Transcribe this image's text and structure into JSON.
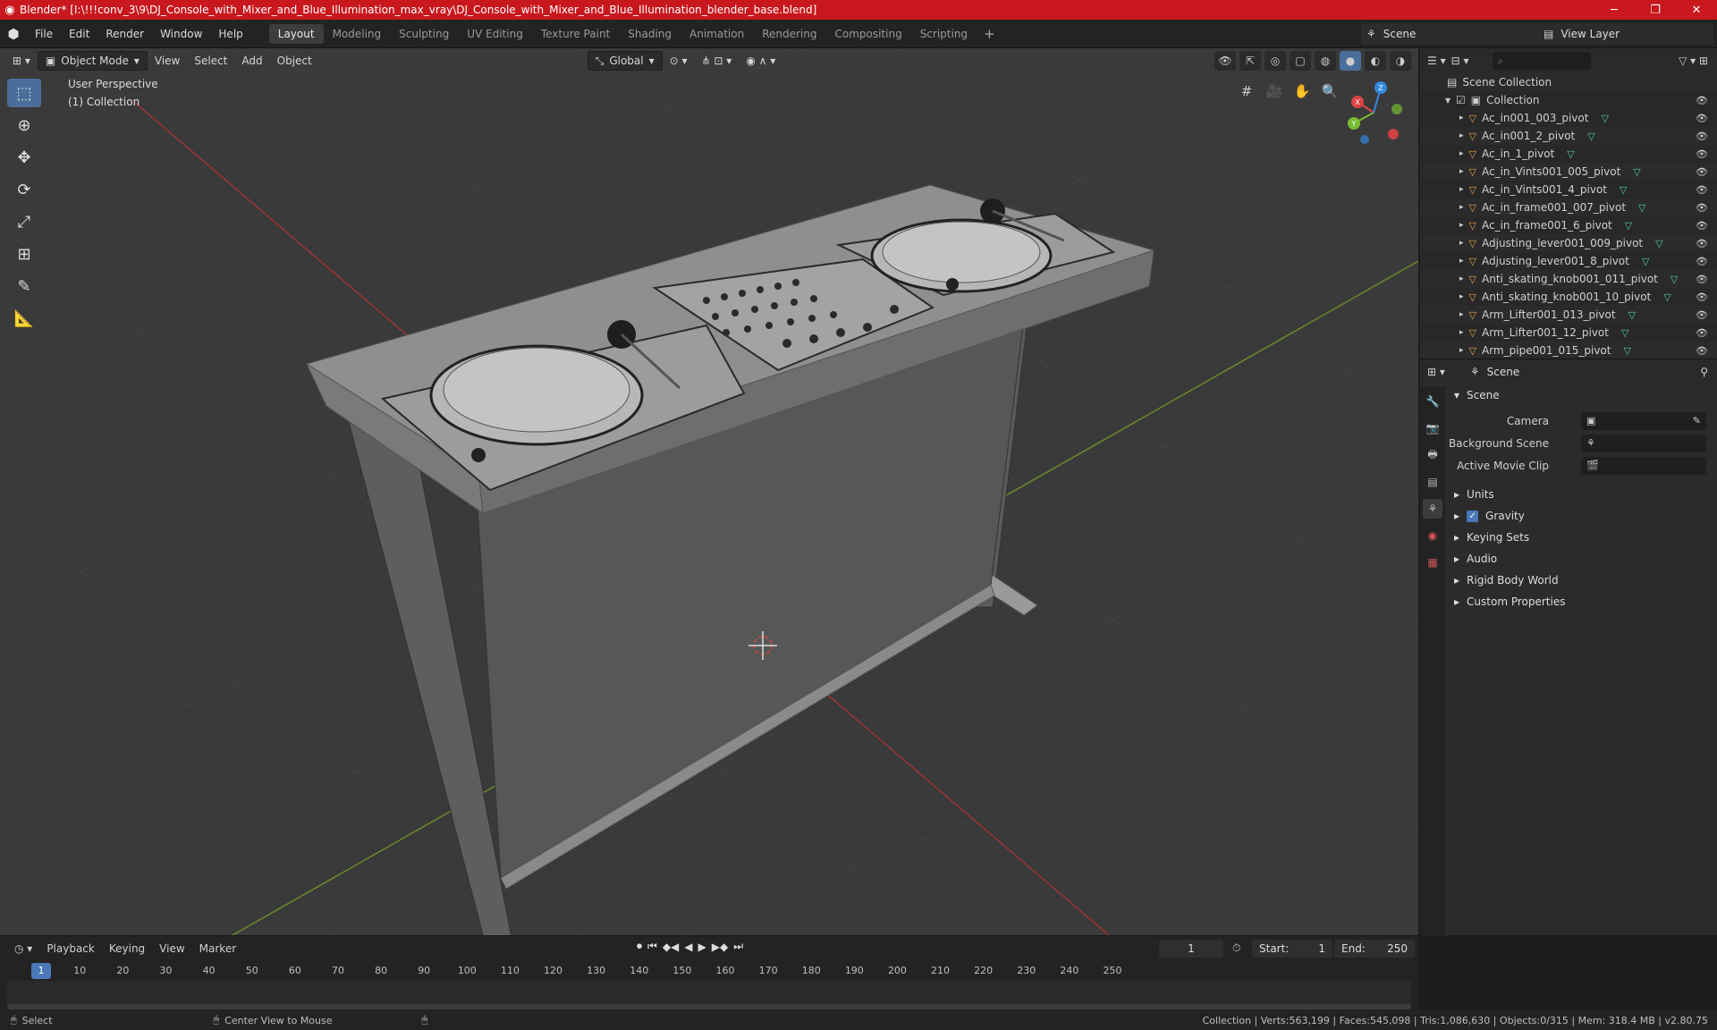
{
  "title": "Blender* [I:\\!!!conv_3\\9\\DJ_Console_with_Mixer_and_Blue_Illumination_max_vray\\DJ_Console_with_Mixer_and_Blue_Illumination_blender_base.blend]",
  "menus": [
    "File",
    "Edit",
    "Render",
    "Window",
    "Help"
  ],
  "workspaces": [
    "Layout",
    "Modeling",
    "Sculpting",
    "UV Editing",
    "Texture Paint",
    "Shading",
    "Animation",
    "Rendering",
    "Compositing",
    "Scripting"
  ],
  "active_workspace": "Layout",
  "scene_name": "Scene",
  "view_layer": "View Layer",
  "viewport": {
    "mode": "Object Mode",
    "menus": [
      "View",
      "Select",
      "Add",
      "Object"
    ],
    "transform": "Global",
    "perspective": "User Perspective",
    "collection": "(1) Collection",
    "gizmo_axes": [
      "X",
      "Y",
      "Z"
    ]
  },
  "outliner": {
    "root": "Scene Collection",
    "collection": "Collection",
    "items": [
      "Ac_in001_003_pivot",
      "Ac_in001_2_pivot",
      "Ac_in_1_pivot",
      "Ac_in_Vints001_005_pivot",
      "Ac_in_Vints001_4_pivot",
      "Ac_in_frame001_007_pivot",
      "Ac_in_frame001_6_pivot",
      "Adjusting_lever001_009_pivot",
      "Adjusting_lever001_8_pivot",
      "Anti_skating_knob001_011_pivot",
      "Anti_skating_knob001_10_pivot",
      "Arm_Lifter001_013_pivot",
      "Arm_Lifter001_12_pivot",
      "Arm_pipe001_015_pivot"
    ]
  },
  "properties": {
    "context": "Scene",
    "panel": "Scene",
    "fields": [
      {
        "label": "Camera",
        "value": ""
      },
      {
        "label": "Background Scene",
        "value": ""
      },
      {
        "label": "Active Movie Clip",
        "value": ""
      }
    ],
    "subpanels": [
      "Units",
      "Gravity",
      "Keying Sets",
      "Audio",
      "Rigid Body World",
      "Custom Properties"
    ],
    "gravity_checked": true
  },
  "timeline": {
    "menus": [
      "Playback",
      "Keying",
      "View",
      "Marker"
    ],
    "current_frame": "1",
    "start_label": "Start:",
    "start": "1",
    "end_label": "End:",
    "end": "250",
    "ticks": [
      "1",
      "10",
      "20",
      "30",
      "40",
      "50",
      "60",
      "70",
      "80",
      "90",
      "100",
      "110",
      "120",
      "130",
      "140",
      "150",
      "160",
      "170",
      "180",
      "190",
      "200",
      "210",
      "220",
      "230",
      "240",
      "250"
    ]
  },
  "status": {
    "select": "Select",
    "center": "Center View to Mouse",
    "stats": "Collection | Verts:563,199 | Faces:545,098 | Tris:1,086,630 | Objects:0/315 | Mem: 318.4 MB | v2.80.75"
  },
  "colors": {
    "title_red": "#c8171d",
    "accent_blue": "#4a78b8",
    "grid_red": "#a03030",
    "grid_green": "#6a8a2a"
  }
}
